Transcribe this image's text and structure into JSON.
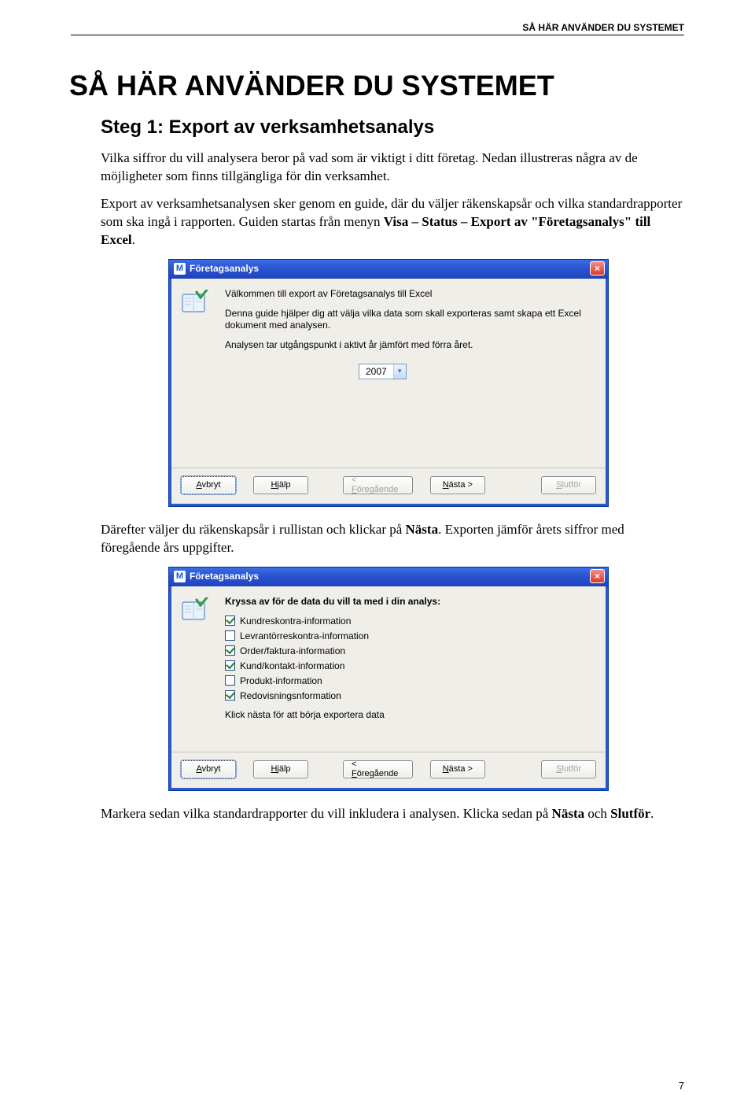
{
  "header": {
    "running_head": "SÅ HÄR ANVÄNDER DU SYSTEMET"
  },
  "page_title": "SÅ HÄR ANVÄNDER DU SYSTEMET",
  "step_title": "Steg 1: Export av verksamhetsanalys",
  "para1": "Vilka siffror du vill analysera beror på vad som är viktigt i ditt företag. Nedan illustreras några av de möjligheter som finns tillgängliga för din verksamhet.",
  "para2_a": "Export av verksamhetsanalysen sker genom en guide, där du väljer räkenskapsår och vilka standardrapporter som ska ingå i rapporten. Guiden startas från menyn ",
  "para2_b": "Visa – Status – Export av \"Företagsanalys\" till Excel",
  "para2_c": ".",
  "dialog1": {
    "title": "Företagsanalys",
    "intro": "Välkommen till export av Företagsanalys till Excel",
    "desc1": "Denna guide hjälper dig att välja vilka data som skall exporteras samt skapa ett Excel dokument med analysen.",
    "desc2": "Analysen tar utgångspunkt i aktivt år jämfört med förra året.",
    "year": "2007",
    "buttons": {
      "avbryt": "Avbryt",
      "hjalp": "Hjälp",
      "foregaende": "Föregående",
      "nasta": "Nästa >",
      "slutfor": "Slutför"
    }
  },
  "para3_a": "Därefter väljer du räkenskapsår i rullistan och klickar på ",
  "para3_b": "Nästa",
  "para3_c": ". Exporten jämför årets siffror med föregående års uppgifter.",
  "dialog2": {
    "title": "Företagsanalys",
    "heading": "Kryssa av för de data du vill ta med i din analys:",
    "items": [
      {
        "label": "Kundreskontra-information",
        "checked": true
      },
      {
        "label": "Levrantörreskontra-information",
        "checked": false
      },
      {
        "label": "Order/faktura-information",
        "checked": true
      },
      {
        "label": "Kund/kontakt-information",
        "checked": true
      },
      {
        "label": "Produkt-information",
        "checked": false
      },
      {
        "label": "Redovisningsnformation",
        "checked": true
      }
    ],
    "footer": "Klick nästa för att börja exportera data",
    "buttons": {
      "avbryt": "Avbryt",
      "hjalp": "Hjälp",
      "foregaende": "Föregående",
      "nasta": "Nästa >",
      "slutfor": "Slutför"
    }
  },
  "para4_a": "Markera sedan vilka standardrapporter du vill inkludera i analysen. Klicka sedan på ",
  "para4_b": "Nästa",
  "para4_c": " och ",
  "para4_d": "Slutför",
  "para4_e": ".",
  "page_number": "7"
}
